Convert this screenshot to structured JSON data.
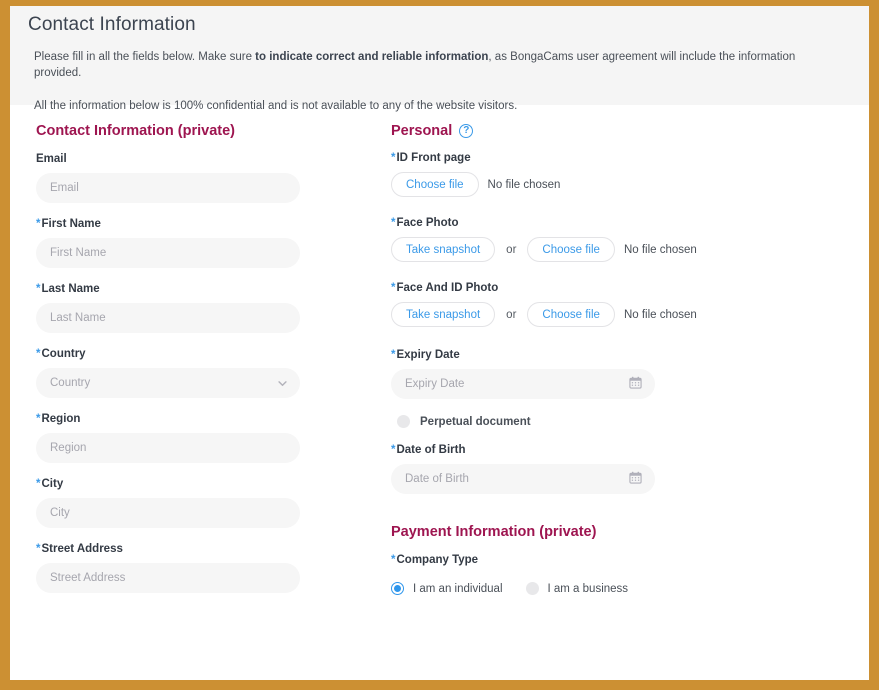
{
  "theme": {
    "frame_color": "#cc9033",
    "heading_color": "#9e1550",
    "accent_blue": "#3b9ae8",
    "band_bg": "#f5f5f5",
    "input_bg": "#f6f6f6"
  },
  "header": {
    "title": "Contact Information",
    "intro_1_a": "Please fill in all the fields below. Make sure ",
    "intro_1_b": "to indicate correct and reliable information",
    "intro_1_c": ", as BongaCams user agreement will include the information provided.",
    "intro_2": "All the information below is 100% confidential and is not available to any of the website visitors."
  },
  "contact_section": {
    "title": "Contact Information (private)",
    "fields": [
      {
        "label": "Email",
        "required": false,
        "placeholder": "Email",
        "type": "text"
      },
      {
        "label": "First Name",
        "required": true,
        "placeholder": "First Name",
        "type": "text"
      },
      {
        "label": "Last Name",
        "required": true,
        "placeholder": "Last Name",
        "type": "text"
      },
      {
        "label": "Country",
        "required": true,
        "placeholder": "Country",
        "type": "select"
      },
      {
        "label": "Region",
        "required": true,
        "placeholder": "Region",
        "type": "text"
      },
      {
        "label": "City",
        "required": true,
        "placeholder": "City",
        "type": "text"
      },
      {
        "label": "Street Address",
        "required": true,
        "placeholder": "Street Address",
        "type": "text"
      }
    ]
  },
  "personal_section": {
    "title": "Personal",
    "help_icon": "question-mark-icon",
    "help_glyph": "?",
    "id_front": {
      "label": "ID Front page",
      "required": true,
      "choose_file_label": "Choose file",
      "status": "No file chosen"
    },
    "face_photo": {
      "label": "Face Photo",
      "required": true,
      "snapshot_label": "Take snapshot",
      "or_label": "or",
      "choose_file_label": "Choose file",
      "status": "No file chosen"
    },
    "face_and_id": {
      "label": "Face And ID Photo",
      "required": true,
      "snapshot_label": "Take snapshot",
      "or_label": "or",
      "choose_file_label": "Choose file",
      "status": "No file chosen"
    },
    "expiry_date": {
      "label": "Expiry Date",
      "required": true,
      "placeholder": "Expiry Date",
      "icon": "calendar-icon"
    },
    "perpetual": {
      "label": "Perpetual document",
      "checked": false
    },
    "date_of_birth": {
      "label": "Date of Birth",
      "required": true,
      "placeholder": "Date of Birth",
      "icon": "calendar-icon"
    }
  },
  "payment_section": {
    "title": "Payment Information (private)",
    "company_type_label": "Company Type",
    "company_type_required": true,
    "options": [
      {
        "label": "I am an individual",
        "selected": true
      },
      {
        "label": "I am a business",
        "selected": false
      }
    ]
  }
}
